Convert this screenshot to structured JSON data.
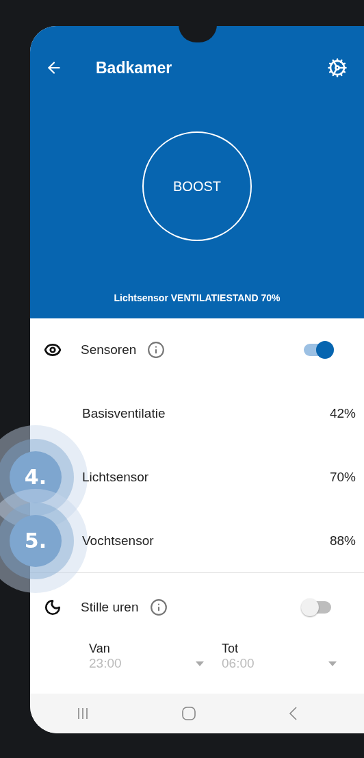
{
  "header": {
    "title": "Badkamer",
    "boost_label": "BOOST",
    "status": "Lichtsensor VENTILATIESTAND 70%"
  },
  "sensors": {
    "label": "Sensoren",
    "on": true,
    "rows": [
      {
        "name": "Basisventilatie",
        "value": "42%"
      },
      {
        "name": "Lichtsensor",
        "value": "70%",
        "callout": "4."
      },
      {
        "name": "Vochtsensor",
        "value": "88%",
        "callout": "5."
      }
    ]
  },
  "quiet_hours": {
    "label": "Stille uren",
    "on": false,
    "fields": [
      {
        "label": "Van",
        "value": "23:00"
      },
      {
        "label": "Tot",
        "value": "06:00"
      }
    ]
  }
}
